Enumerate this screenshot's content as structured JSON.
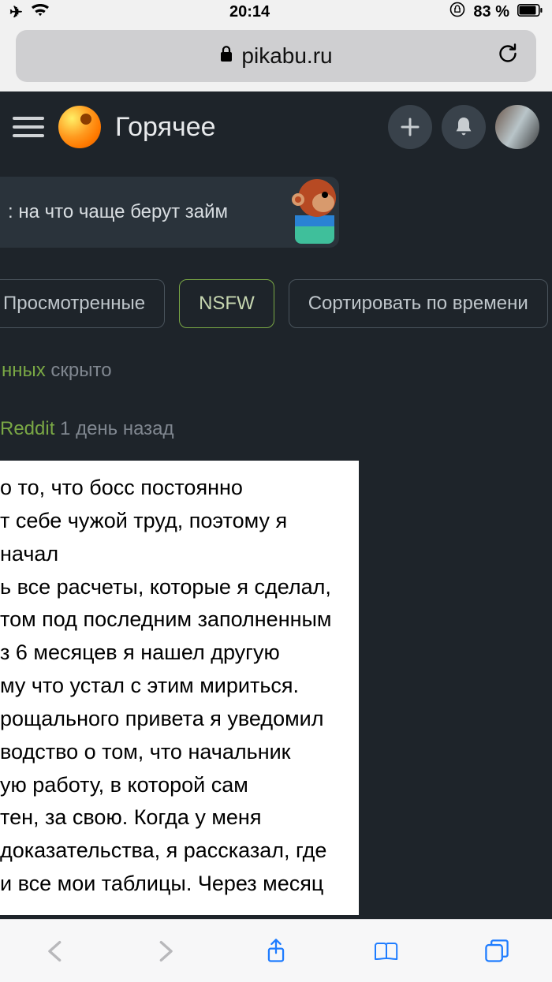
{
  "status_bar": {
    "time": "20:14",
    "battery_percent": "83 %"
  },
  "browser": {
    "domain": "pikabu.ru"
  },
  "header": {
    "section_title": "Горячее"
  },
  "promo": {
    "text": ": на что чаще берут займ"
  },
  "chips": {
    "viewed": "Просмотренные",
    "nsfw": "NSFW",
    "sort_time": "Сортировать по времени"
  },
  "hidden_line": {
    "accent": "нных",
    "rest": " скрыто"
  },
  "post": {
    "source": "Reddit",
    "age": "1 день назад",
    "body": "о то, что босс постоянно\nт себе чужой труд, поэтому я начал\nь все расчеты, которые я сделал,\nтом под последним заполненным\nз 6 месяцев я нашел другую\nму что устал с этим мириться.\nрощального привета я уведомил\nводство о том, что начальник\nую работу, в которой сам\nтен, за свою. Когда у меня\nдоказательства, я рассказал, где\nи все мои таблицы. Через месяц"
  }
}
